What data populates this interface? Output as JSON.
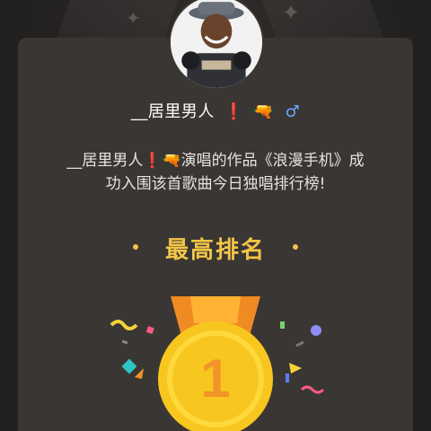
{
  "user": {
    "name": "__居里男人",
    "emoji_exclamation": "❗",
    "emoji_gun": "🔫",
    "gender_symbol": "♂"
  },
  "message": {
    "line1": "__居里男人❗🔫演唱的作品《浪漫手机》成",
    "line2": "功入围该首歌曲今日独唱排行榜!"
  },
  "rank": {
    "title": "最高排名",
    "number": "1"
  },
  "colors": {
    "background": "#232120",
    "card": "#3a3634",
    "accent": "#f3c646",
    "gender": "#69a6ff"
  },
  "icons": [
    "sparkle-icon",
    "avatar",
    "medal-icon",
    "confetti-icon"
  ]
}
